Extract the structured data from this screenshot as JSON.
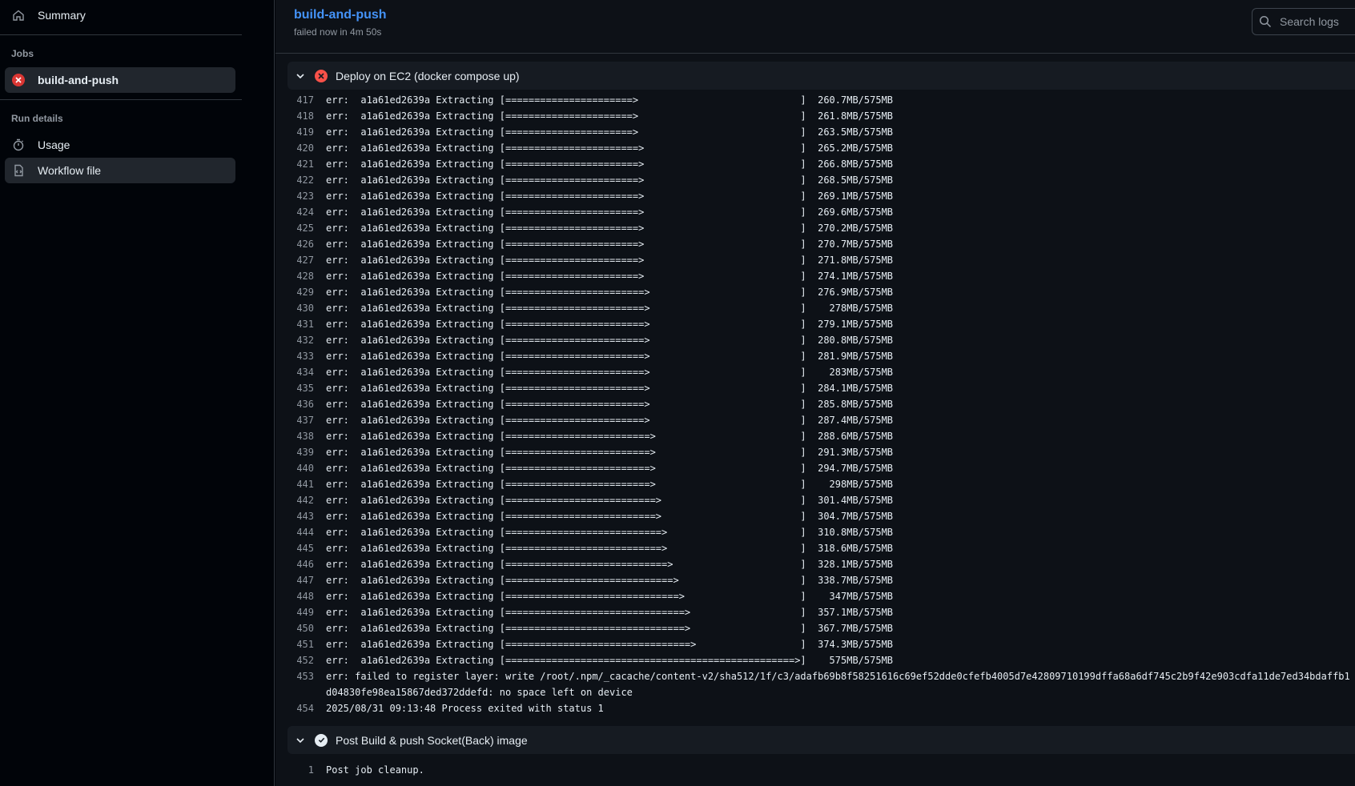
{
  "sidebar": {
    "summary_label": "Summary",
    "jobs_heading": "Jobs",
    "job_label": "build-and-push",
    "run_details_heading": "Run details",
    "usage_label": "Usage",
    "workflow_file_label": "Workflow file"
  },
  "header": {
    "job_title": "build-and-push",
    "job_status": "failed now in 4m 50s",
    "search_placeholder": "Search logs"
  },
  "steps": {
    "deploy": {
      "title": "Deploy on EC2 (docker compose up)",
      "status": "failed"
    },
    "post_build": {
      "title": "Post Build & push Socket(Back) image",
      "status": "succeeded"
    }
  },
  "deploy_log": [
    {
      "n": "417",
      "t": "err:  a1a61ed2639a Extracting [======================>                            ]  260.7MB/575MB"
    },
    {
      "n": "418",
      "t": "err:  a1a61ed2639a Extracting [======================>                            ]  261.8MB/575MB"
    },
    {
      "n": "419",
      "t": "err:  a1a61ed2639a Extracting [======================>                            ]  263.5MB/575MB"
    },
    {
      "n": "420",
      "t": "err:  a1a61ed2639a Extracting [=======================>                           ]  265.2MB/575MB"
    },
    {
      "n": "421",
      "t": "err:  a1a61ed2639a Extracting [=======================>                           ]  266.8MB/575MB"
    },
    {
      "n": "422",
      "t": "err:  a1a61ed2639a Extracting [=======================>                           ]  268.5MB/575MB"
    },
    {
      "n": "423",
      "t": "err:  a1a61ed2639a Extracting [=======================>                           ]  269.1MB/575MB"
    },
    {
      "n": "424",
      "t": "err:  a1a61ed2639a Extracting [=======================>                           ]  269.6MB/575MB"
    },
    {
      "n": "425",
      "t": "err:  a1a61ed2639a Extracting [=======================>                           ]  270.2MB/575MB"
    },
    {
      "n": "426",
      "t": "err:  a1a61ed2639a Extracting [=======================>                           ]  270.7MB/575MB"
    },
    {
      "n": "427",
      "t": "err:  a1a61ed2639a Extracting [=======================>                           ]  271.8MB/575MB"
    },
    {
      "n": "428",
      "t": "err:  a1a61ed2639a Extracting [=======================>                           ]  274.1MB/575MB"
    },
    {
      "n": "429",
      "t": "err:  a1a61ed2639a Extracting [========================>                          ]  276.9MB/575MB"
    },
    {
      "n": "430",
      "t": "err:  a1a61ed2639a Extracting [========================>                          ]    278MB/575MB"
    },
    {
      "n": "431",
      "t": "err:  a1a61ed2639a Extracting [========================>                          ]  279.1MB/575MB"
    },
    {
      "n": "432",
      "t": "err:  a1a61ed2639a Extracting [========================>                          ]  280.8MB/575MB"
    },
    {
      "n": "433",
      "t": "err:  a1a61ed2639a Extracting [========================>                          ]  281.9MB/575MB"
    },
    {
      "n": "434",
      "t": "err:  a1a61ed2639a Extracting [========================>                          ]    283MB/575MB"
    },
    {
      "n": "435",
      "t": "err:  a1a61ed2639a Extracting [========================>                          ]  284.1MB/575MB"
    },
    {
      "n": "436",
      "t": "err:  a1a61ed2639a Extracting [========================>                          ]  285.8MB/575MB"
    },
    {
      "n": "437",
      "t": "err:  a1a61ed2639a Extracting [========================>                          ]  287.4MB/575MB"
    },
    {
      "n": "438",
      "t": "err:  a1a61ed2639a Extracting [=========================>                         ]  288.6MB/575MB"
    },
    {
      "n": "439",
      "t": "err:  a1a61ed2639a Extracting [=========================>                         ]  291.3MB/575MB"
    },
    {
      "n": "440",
      "t": "err:  a1a61ed2639a Extracting [=========================>                         ]  294.7MB/575MB"
    },
    {
      "n": "441",
      "t": "err:  a1a61ed2639a Extracting [=========================>                         ]    298MB/575MB"
    },
    {
      "n": "442",
      "t": "err:  a1a61ed2639a Extracting [==========================>                        ]  301.4MB/575MB"
    },
    {
      "n": "443",
      "t": "err:  a1a61ed2639a Extracting [==========================>                        ]  304.7MB/575MB"
    },
    {
      "n": "444",
      "t": "err:  a1a61ed2639a Extracting [===========================>                       ]  310.8MB/575MB"
    },
    {
      "n": "445",
      "t": "err:  a1a61ed2639a Extracting [===========================>                       ]  318.6MB/575MB"
    },
    {
      "n": "446",
      "t": "err:  a1a61ed2639a Extracting [============================>                      ]  328.1MB/575MB"
    },
    {
      "n": "447",
      "t": "err:  a1a61ed2639a Extracting [=============================>                     ]  338.7MB/575MB"
    },
    {
      "n": "448",
      "t": "err:  a1a61ed2639a Extracting [==============================>                    ]    347MB/575MB"
    },
    {
      "n": "449",
      "t": "err:  a1a61ed2639a Extracting [===============================>                   ]  357.1MB/575MB"
    },
    {
      "n": "450",
      "t": "err:  a1a61ed2639a Extracting [===============================>                   ]  367.7MB/575MB"
    },
    {
      "n": "451",
      "t": "err:  a1a61ed2639a Extracting [================================>                  ]  374.3MB/575MB"
    },
    {
      "n": "452",
      "t": "err:  a1a61ed2639a Extracting [==================================================>]    575MB/575MB"
    },
    {
      "n": "453",
      "t": "err: failed to register layer: write /root/.npm/_cacache/content-v2/sha512/1f/c3/adafb69b8f58251616c69ef52dde0cfefb4005d7e42809710199dffa68a6df745c2b9f42e903cdfa11de7ed34bdaffb1d04830fe98ea15867ded372ddefd: no space left on device",
      "wrap": true
    },
    {
      "n": "454",
      "t": "2025/08/31 09:13:48 Process exited with status 1"
    }
  ],
  "post_log": [
    {
      "n": "1",
      "t": "Post job cleanup."
    }
  ],
  "colors": {
    "accent_link": "#4493f8",
    "fail": "#da3633",
    "background": "#0d1117",
    "sidebar_bg": "#010409"
  },
  "icons": {
    "summary": "home-icon",
    "job_status": "x-circle-icon",
    "usage": "stopwatch-icon",
    "workflow": "workflow-file-icon",
    "search": "search-icon",
    "chevron": "chevron-down-icon"
  }
}
